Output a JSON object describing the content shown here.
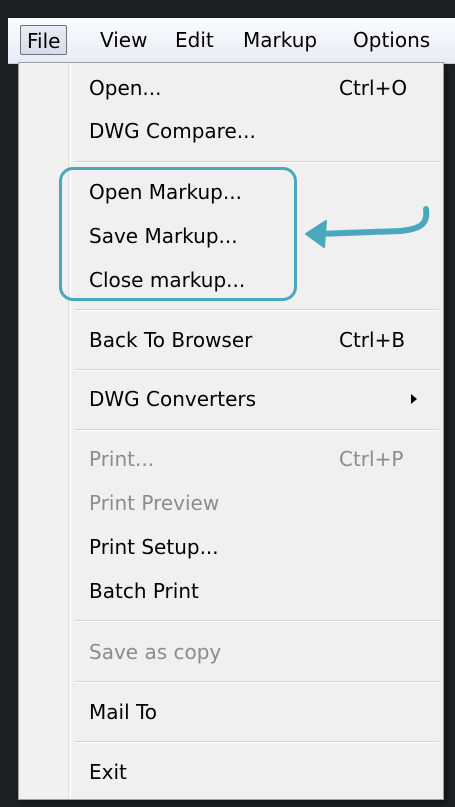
{
  "menubar": {
    "items": [
      {
        "label": "File"
      },
      {
        "label": "View"
      },
      {
        "label": "Edit"
      },
      {
        "label": "Markup"
      },
      {
        "label": "Options"
      }
    ]
  },
  "file_menu": {
    "open": {
      "label": "Open...",
      "shortcut": "Ctrl+O"
    },
    "dwg_compare": {
      "label": "DWG Compare..."
    },
    "open_markup": {
      "label": "Open Markup..."
    },
    "save_markup": {
      "label": "Save Markup..."
    },
    "close_markup": {
      "label": "Close markup..."
    },
    "back_to_browser": {
      "label": "Back To Browser",
      "shortcut": "Ctrl+B"
    },
    "dwg_converters": {
      "label": "DWG Converters"
    },
    "print": {
      "label": "Print...",
      "shortcut": "Ctrl+P"
    },
    "print_preview": {
      "label": "Print Preview"
    },
    "print_setup": {
      "label": "Print Setup..."
    },
    "batch_print": {
      "label": "Batch Print"
    },
    "save_as_copy": {
      "label": "Save as copy"
    },
    "mail_to": {
      "label": "Mail To"
    },
    "exit": {
      "label": "Exit"
    }
  },
  "annotation": {
    "highlight_color": "#4aa8bd"
  },
  "colors": {
    "disabled_text": "#8c8c8c",
    "menu_bg": "#f0f0f0"
  }
}
